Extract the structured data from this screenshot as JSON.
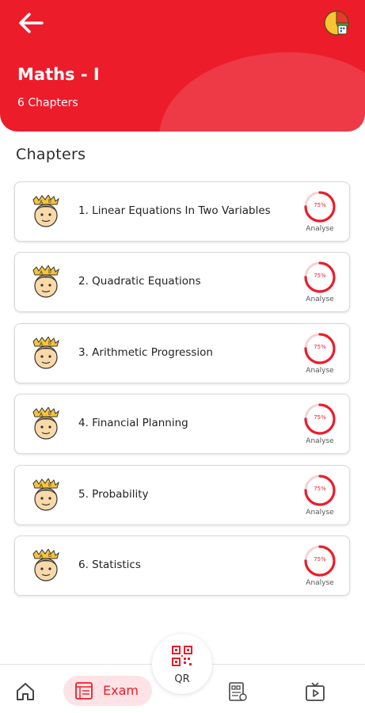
{
  "header": {
    "title": "Maths - I",
    "subtitle": "6 Chapters",
    "color": "#ec1c2b"
  },
  "section_title": "Chapters",
  "chapters": [
    {
      "title": "1. Linear Equations In Two Variables",
      "progress_label": "75%",
      "progress": 0.75,
      "action": "Analyse"
    },
    {
      "title": "2. Quadratic Equations",
      "progress_label": "75%",
      "progress": 0.75,
      "action": "Analyse"
    },
    {
      "title": "3. Arithmetic Progression",
      "progress_label": "75%",
      "progress": 0.75,
      "action": "Analyse"
    },
    {
      "title": "4. Financial Planning",
      "progress_label": "75%",
      "progress": 0.75,
      "action": "Analyse"
    },
    {
      "title": "5. Probability",
      "progress_label": "75%",
      "progress": 0.75,
      "action": "Analyse"
    },
    {
      "title": "6. Statistics",
      "progress_label": "75%",
      "progress": 0.75,
      "action": "Analyse"
    }
  ],
  "bottom_nav": {
    "home_icon": "home-icon",
    "exam_label": "Exam",
    "qr_label": "QR",
    "report_icon": "report-icon",
    "video_icon": "video-icon"
  }
}
